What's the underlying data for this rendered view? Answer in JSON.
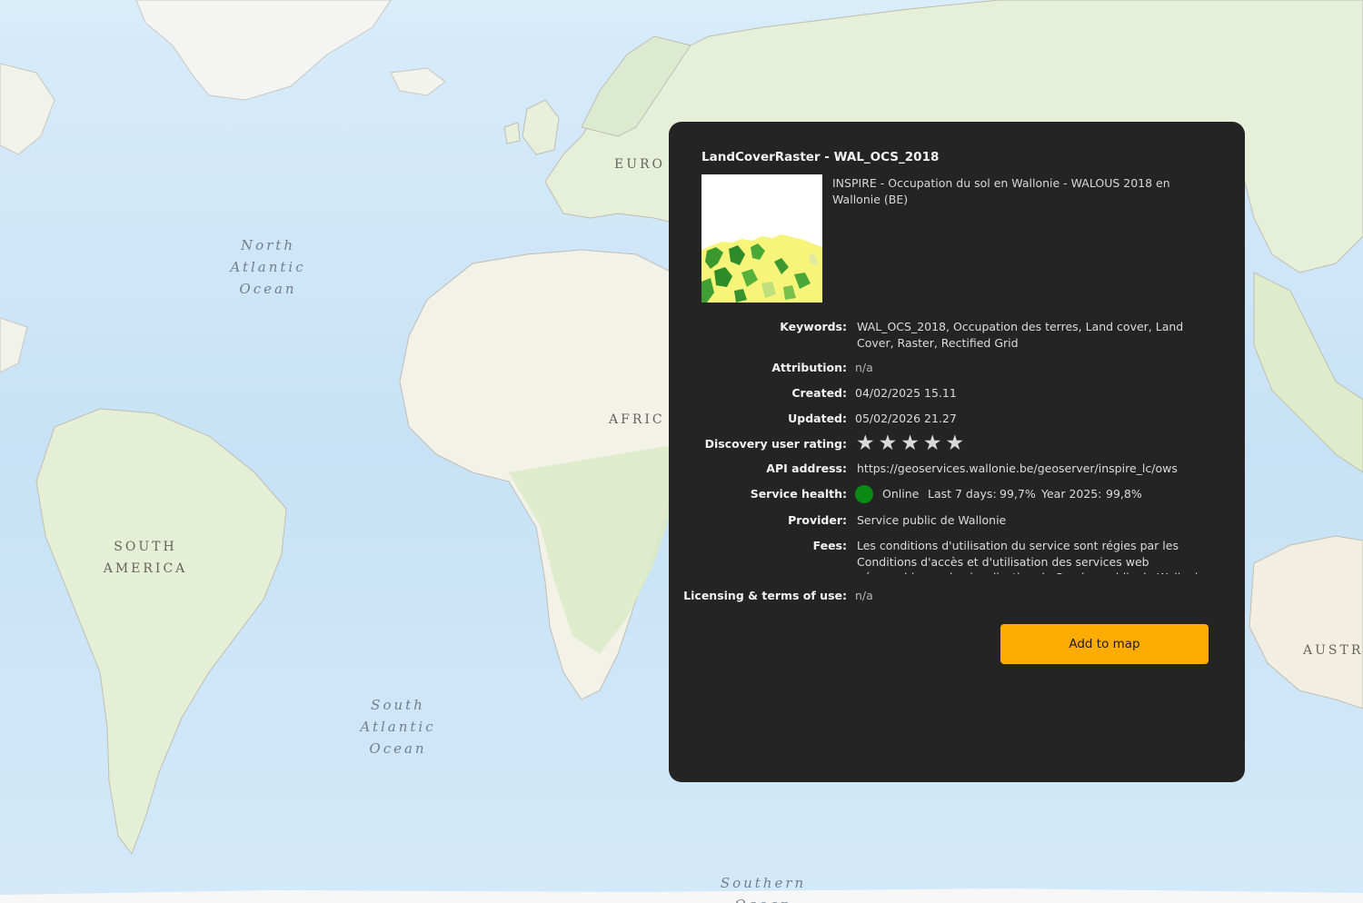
{
  "map": {
    "labels": {
      "north_atlantic": [
        "North",
        "Atlantic",
        "Ocean"
      ],
      "south_atlantic": [
        "South",
        "Atlantic",
        "Ocean"
      ],
      "southern_ocean": [
        "Southern",
        "Ocean"
      ],
      "south_america": [
        "SOUTH",
        "AMERICA"
      ],
      "europe": "EURO",
      "africa": "AFRIC",
      "australia": "AUSTR"
    },
    "colors": {
      "ocean": "#cfe6f7",
      "land": "#f3f2ea",
      "vegetation": "#dfeccf",
      "border": "#b9b6ad"
    }
  },
  "panel": {
    "title": "LandCoverRaster - WAL_OCS_2018",
    "subtitle": "INSPIRE - Occupation du sol en Wallonie - WALOUS 2018 en Wallonie (BE)",
    "thumbnail_icon": "land-cover-raster-preview",
    "fields": {
      "keywords": {
        "label": "Keywords:",
        "value": "WAL_OCS_2018, Occupation des terres, Land cover, Land Cover, Raster, Rectified Grid"
      },
      "attribution": {
        "label": "Attribution:",
        "value": "n/a"
      },
      "created": {
        "label": "Created:",
        "value": "04/02/2025 15.11"
      },
      "updated": {
        "label": "Updated:",
        "value": "05/02/2026 21.27"
      },
      "rating": {
        "label": "Discovery user rating:",
        "stars": 5,
        "filled": 0
      },
      "api": {
        "label": "API address:",
        "value": "https://geoservices.wallonie.be/geoserver/inspire_lc/ows"
      },
      "health": {
        "label": "Service health:",
        "status": "Online",
        "last7_label": "Last 7 days:",
        "last7_value": "99,7%",
        "year_label": "Year 2025:",
        "year_value": "99,8%",
        "status_color": "#0a8a12"
      },
      "provider": {
        "label": "Provider:",
        "value": "Service public de Wallonie"
      },
      "fees": {
        "label": "Fees:",
        "value": "Les conditions d'utilisation du service sont régies par les Conditions d'accès et d'utilisation des services web géographiques de visualisation du Service public de Wallonie"
      },
      "licensing": {
        "label": "Licensing & terms of use:",
        "value": "n/a"
      }
    },
    "add_button": "Add to map",
    "accent_color": "#ffac00"
  }
}
